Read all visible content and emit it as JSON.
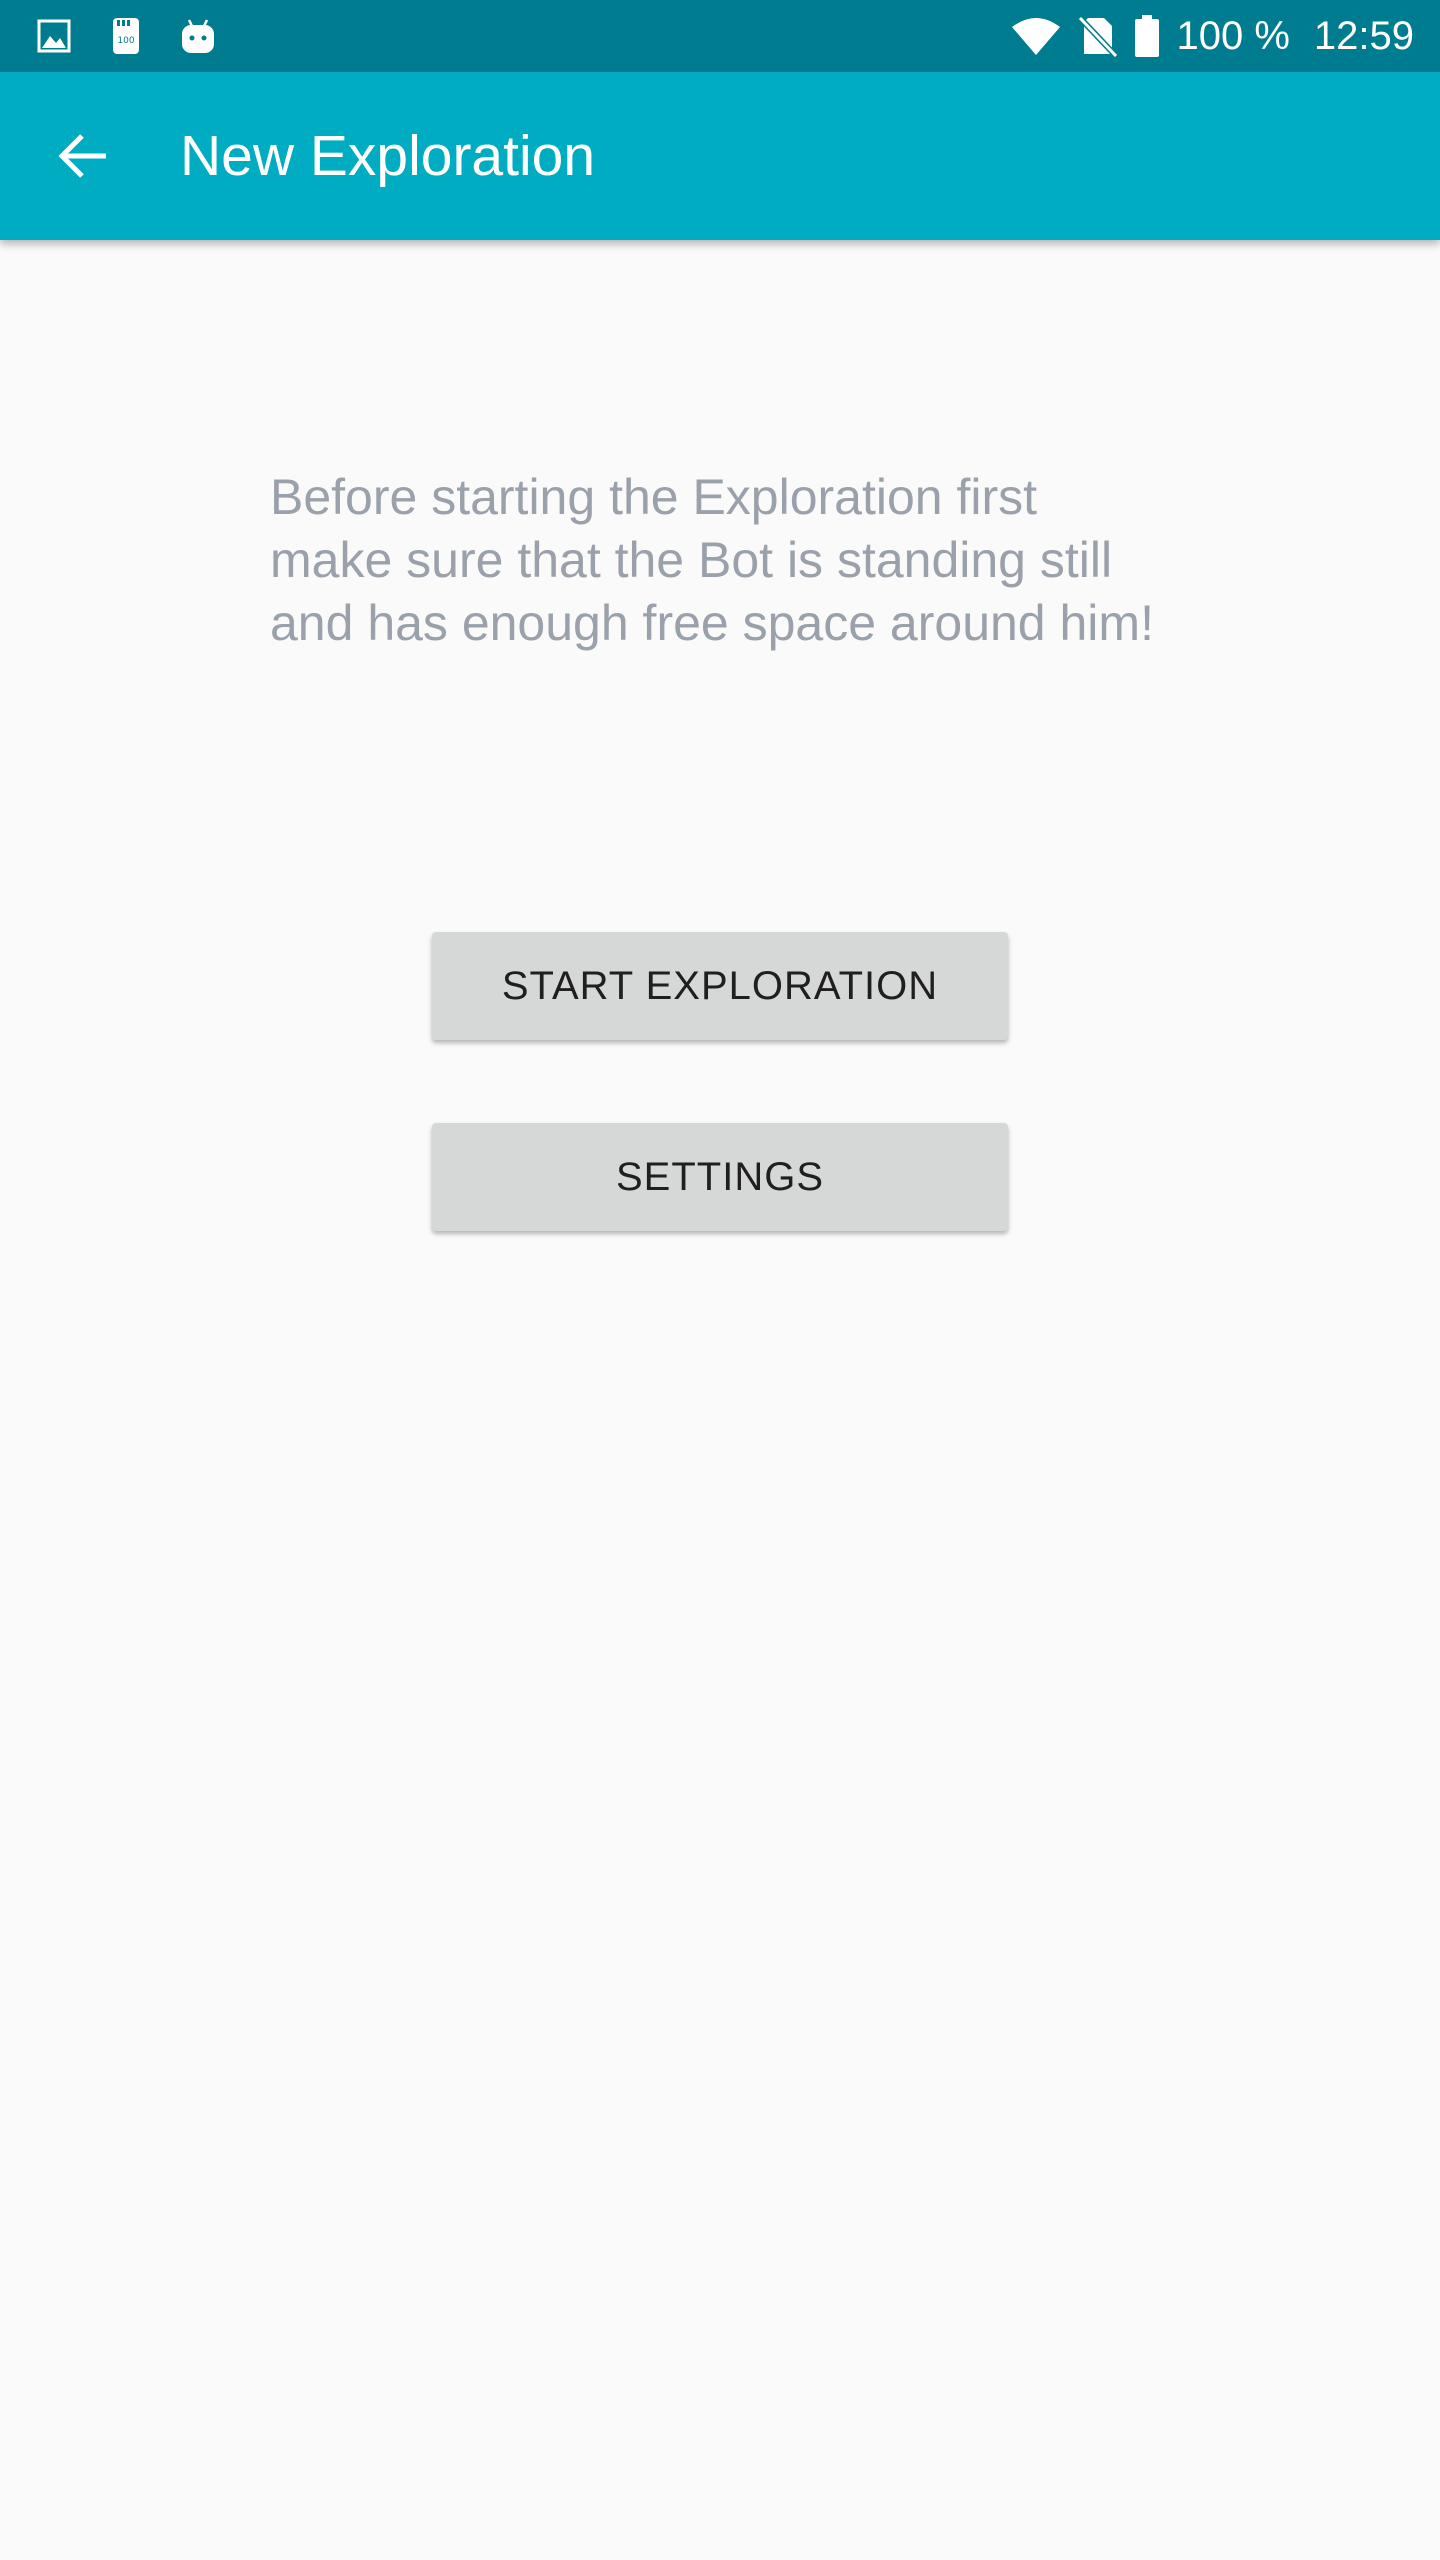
{
  "status_bar": {
    "battery_percent": "100 %",
    "time": "12:59",
    "notification_icons": [
      "image-icon",
      "sd-card-icon",
      "android-icon"
    ],
    "system_icons": [
      "wifi-icon",
      "no-sim-icon",
      "battery-icon"
    ],
    "sd_icon_text": "100"
  },
  "app_bar": {
    "title": "New Exploration",
    "back_icon": "arrow-back-icon"
  },
  "main": {
    "message": "Before starting the Exploration first make sure that the Bot is standing still and has enough free space around him!",
    "start_button_label": "START EXPLORATION",
    "settings_button_label": "SETTINGS"
  },
  "colors": {
    "status_bar": "#007c91",
    "app_bar": "#00acc1",
    "background": "#fafafa",
    "message_text": "#9aa1ab",
    "button_bg": "#d6d7d7",
    "button_text": "#1f1f1f"
  }
}
